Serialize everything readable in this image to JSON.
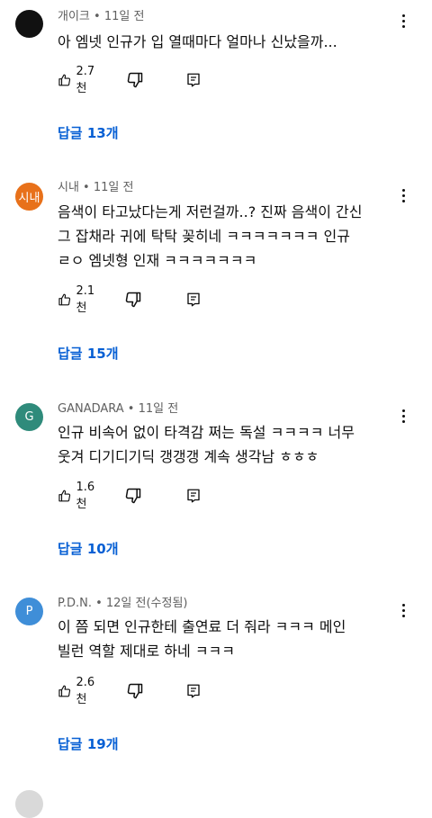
{
  "comments": [
    {
      "avatar_text": "",
      "avatar_color": "#111111",
      "author": "개이크",
      "time": "11일 전",
      "lines": [
        "아 엠넷 인규가 입 열때마다 얼마나 신났을까..."
      ],
      "likes": "2.7천",
      "replies": "답글 13개"
    },
    {
      "avatar_text": "시내",
      "avatar_color": "#e8711a",
      "author": "시내",
      "time": "11일 전",
      "lines": [
        "음색이 타고났다는게 저런걸까..? 진짜 음색이 간신",
        "그 잡채라 귀에 탁탁 꽂히네 ㅋㅋㅋㅋㅋㅋㅋ 인규",
        "ㄹㅇ 엠넷형 인재 ㅋㅋㅋㅋㅋㅋㅋ"
      ],
      "likes": "2.1천",
      "replies": "답글 15개"
    },
    {
      "avatar_text": "G",
      "avatar_color": "#2f8b7b",
      "author": "GANADARA",
      "time": "11일 전",
      "lines": [
        "인규 비속어 없이 타격감 쩌는 독설 ㅋㅋㅋㅋ 너무",
        "웃겨 디기디기딕 갱갱갱 계속 생각남 ㅎㅎㅎ"
      ],
      "likes": "1.6천",
      "replies": "답글 10개"
    },
    {
      "avatar_text": "P",
      "avatar_color": "#3f8ed8",
      "author": "P.D.N.",
      "time": "12일 전(수정됨)",
      "lines": [
        "이 쯤 되면 인규한테 출연료 더 줘라 ㅋㅋㅋ 메인",
        "빌런 역할 제대로 하네 ㅋㅋㅋ"
      ],
      "likes": "2.6천",
      "replies": "답글 19개"
    }
  ],
  "separator": " • ",
  "icons": {
    "like": "thumbs-up-icon",
    "dislike": "thumbs-down-icon",
    "reply": "comment-reply-icon",
    "more": "more-vertical-icon"
  }
}
